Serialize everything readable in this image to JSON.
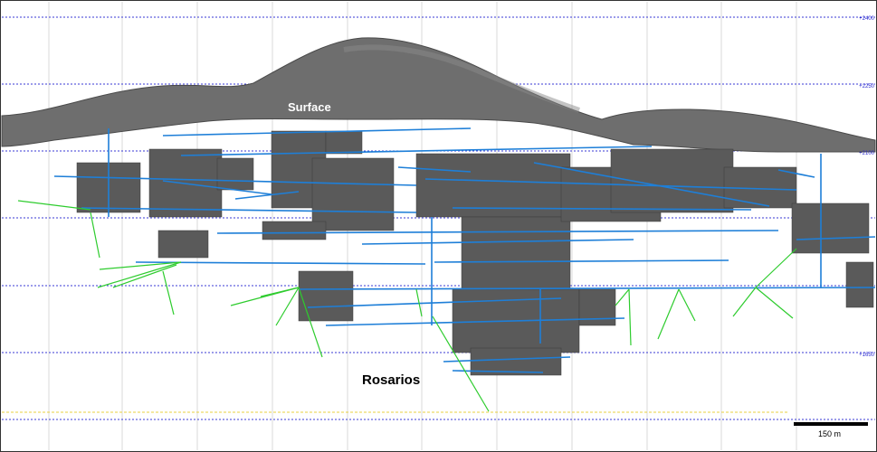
{
  "labels": {
    "surface": "Surface",
    "mine": "Rosarios"
  },
  "elevations": [
    "+2400",
    "+2250",
    "+2100",
    "+1650"
  ],
  "scale": {
    "label": "150 m"
  },
  "colors": {
    "level_lines": "#3a3ad6",
    "workings": "#1e7fd8",
    "drillholes": "#2ecc2e",
    "stopes": "#555555",
    "surface": "#6e6e6e",
    "water_line": "#e8d040"
  }
}
